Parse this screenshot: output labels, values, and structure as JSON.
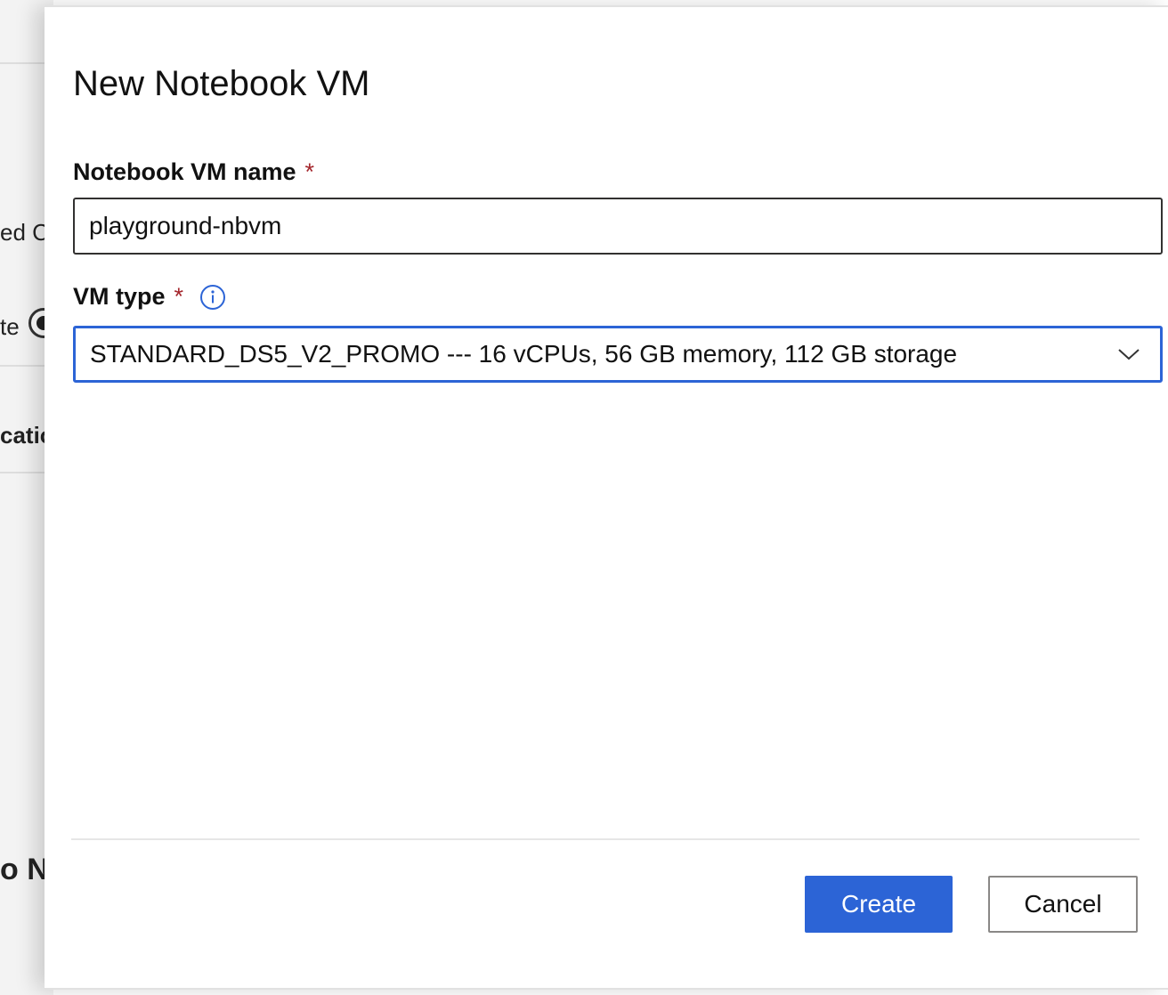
{
  "background": {
    "fragments": [
      "ed C",
      "te",
      "catio",
      "o N"
    ]
  },
  "dialog": {
    "title": "New Notebook VM",
    "name_field": {
      "label": "Notebook VM name",
      "required_marker": "*",
      "value": "playground-nbvm"
    },
    "vm_type_field": {
      "label": "VM type",
      "required_marker": "*",
      "info_icon": "info-icon",
      "selected_value": "STANDARD_DS5_V2_PROMO --- 16 vCPUs, 56 GB memory, 112 GB storage",
      "dropdown_icon": "chevron-down-icon"
    },
    "buttons": {
      "create_label": "Create",
      "cancel_label": "Cancel"
    }
  },
  "colors": {
    "accent": "#2c64d6",
    "required": "#a4262c"
  }
}
